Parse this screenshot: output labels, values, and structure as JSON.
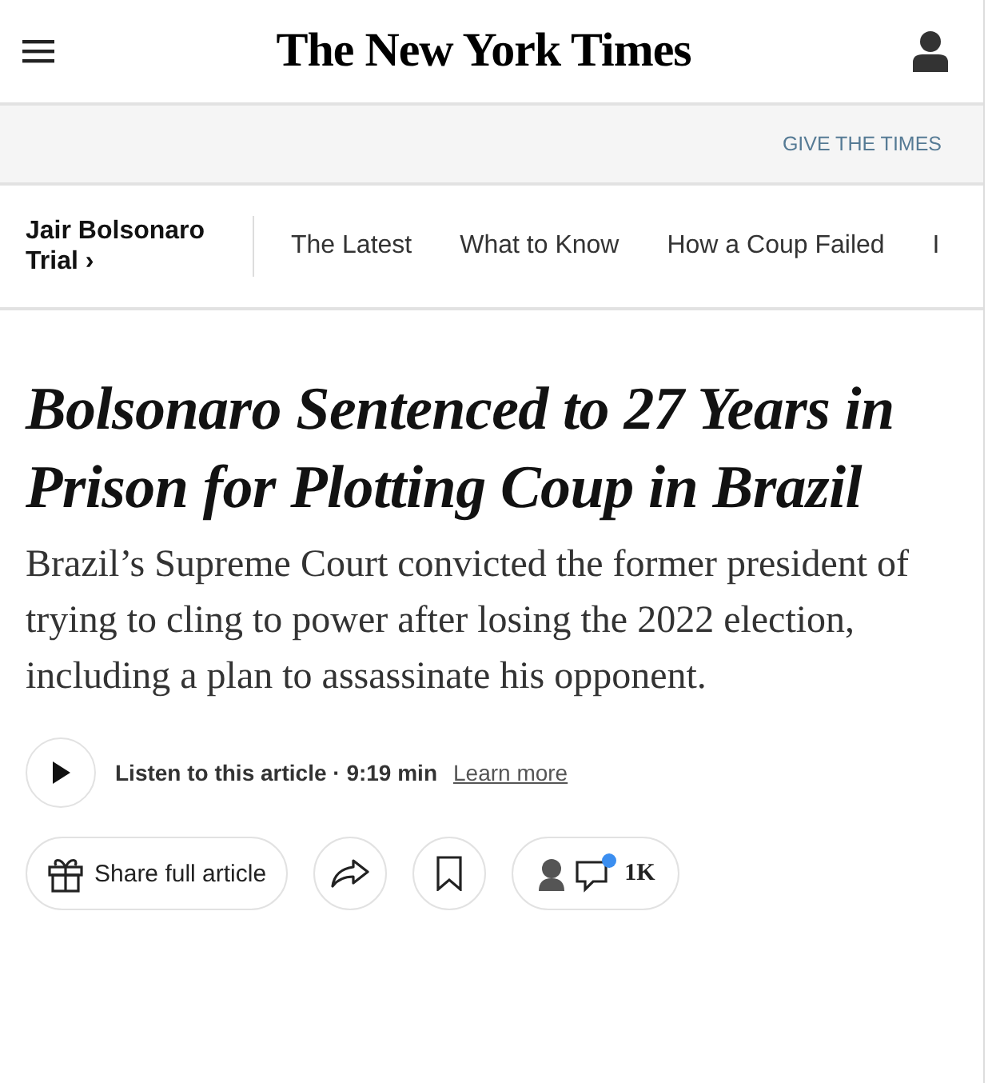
{
  "header": {
    "logo": "The New York Times"
  },
  "promo": {
    "link": "GIVE THE TIMES"
  },
  "topic_nav": {
    "title": "Jair Bolsonaro Trial ›",
    "items": [
      {
        "label": "The Latest"
      },
      {
        "label": "What to Know"
      },
      {
        "label": "How a Coup Failed"
      },
      {
        "label": "I"
      }
    ]
  },
  "article": {
    "headline": "Bolsonaro Sentenced to 27 Years in Prison for Plotting Coup in Brazil",
    "summary": "Brazil’s Supreme Court convicted the former president of trying to cling to power after losing the 2022 election, including a plan to assassinate his opponent.",
    "audio": {
      "label": "Listen to this article · 9:19 min",
      "link": "Learn more"
    },
    "actions": {
      "share": "Share full article",
      "comments": "1K",
      "comments_unread": true
    }
  }
}
